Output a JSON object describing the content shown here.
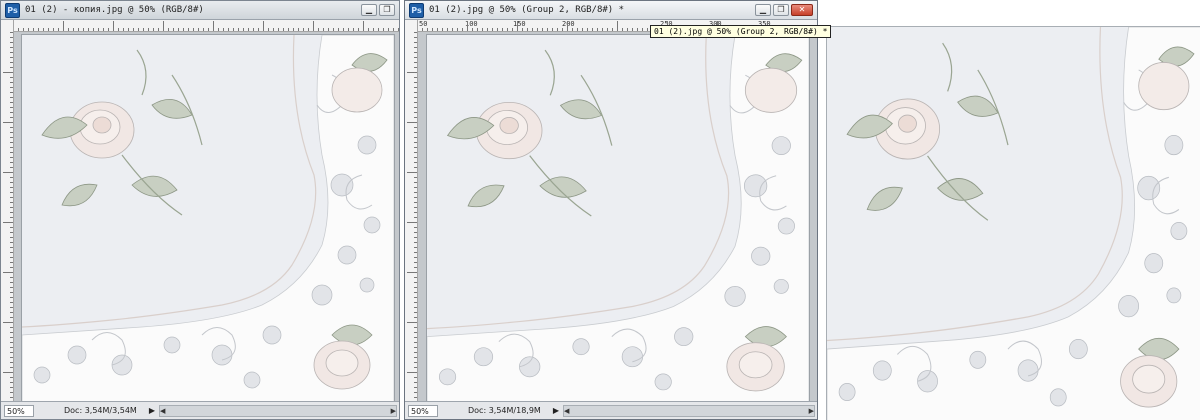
{
  "windows": [
    {
      "title": "01 (2) - копия.jpg @ 50% (RGB/8#)",
      "zoom": "50%",
      "doc_info": "Doc: 3,54M/3,54M",
      "active": false
    },
    {
      "title": "01 (2).jpg @ 50% (Group 2, RGB/8#) *",
      "zoom": "50%",
      "doc_info": "Doc: 3,54M/18,9M",
      "active": true
    }
  ],
  "ruler_top_labels": [
    "50",
    "100",
    "150",
    "200",
    "250",
    "300",
    "350"
  ],
  "tooltip": "01 (2).jpg @ 50% (Group 2, RGB/8#) *",
  "window_buttons": {
    "minimize": "▁",
    "restore": "❐",
    "close": "✕"
  },
  "icons": {
    "app": "Ps",
    "scroll_left": "◀",
    "scroll_right": "▶"
  },
  "colors": {
    "fabric": "#eef0f3",
    "embroidery_leaf": "#9aa592",
    "embroidery_rose": "#e8d8d4",
    "lace": "#f8f8f8",
    "ps_icon": "#1f5fa8"
  }
}
